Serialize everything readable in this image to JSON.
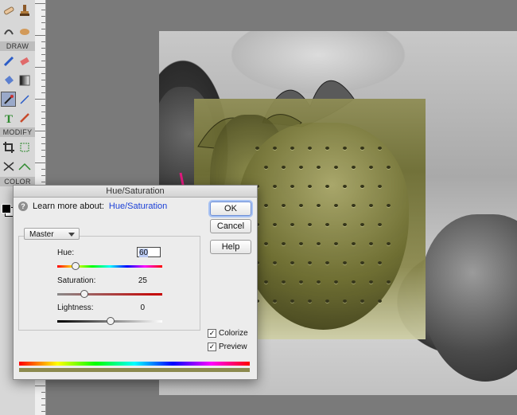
{
  "toolbar": {
    "sections": [
      "DRAW",
      "MODIFY",
      "COLOR"
    ],
    "tools": [
      "stamp-icon",
      "bandage-icon",
      "blur-icon",
      "brush-icon",
      "eraser-icon",
      "bucket-icon",
      "gradient-icon",
      "eyedropper-icon",
      "line-icon",
      "type-icon",
      "pencil-icon",
      "crop-icon",
      "transform-icon",
      "tangle-icon",
      "straighten-icon"
    ]
  },
  "dialog": {
    "title": "Hue/Saturation",
    "learn_prefix": "Learn more about:",
    "learn_link": "Hue/Saturation",
    "buttons": {
      "ok": "OK",
      "cancel": "Cancel",
      "help": "Help"
    },
    "preset": "Master",
    "hue": {
      "label": "Hue:",
      "value": "60"
    },
    "saturation": {
      "label": "Saturation:",
      "value": "25"
    },
    "lightness": {
      "label": "Lightness:",
      "value": "0"
    },
    "colorize": {
      "label": "Colorize",
      "checked": true
    },
    "preview": {
      "label": "Preview",
      "checked": true
    },
    "slider_levels": {
      "hue": 0.167,
      "saturation": 0.25,
      "lightness": 0.5
    }
  },
  "colors": {
    "accent_arrow": "#e0197d",
    "tint": "#8c8a4f",
    "ok_focus": "#6e8fd6"
  }
}
